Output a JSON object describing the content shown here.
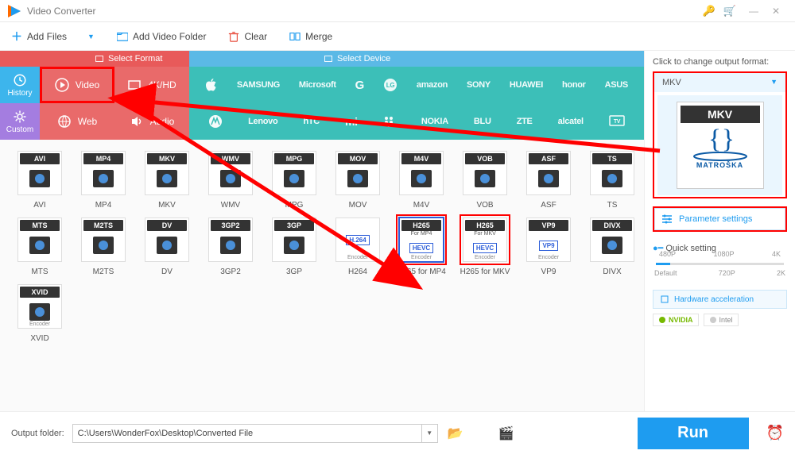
{
  "title": "Video Converter",
  "toolbar": {
    "add_files": "Add Files",
    "add_folder": "Add Video Folder",
    "clear": "Clear",
    "merge": "Merge"
  },
  "tabs": {
    "select_format": "Select Format",
    "select_device": "Select Device"
  },
  "side": {
    "history": "History",
    "custom": "Custom"
  },
  "cats": {
    "video": "Video",
    "fourk": "4K/HD",
    "web": "Web",
    "audio": "Audio"
  },
  "brands_row1": [
    "",
    "SAMSUNG",
    "Microsoft",
    "G",
    "LG",
    "amazon",
    "SONY",
    "HUAWEI",
    "honor",
    "ASUS"
  ],
  "brands_row2": [
    "",
    "Lenovo",
    "hTC",
    "mi",
    "",
    "NOKIA",
    "BLU",
    "ZTE",
    "alcatel",
    "TV"
  ],
  "formats": [
    {
      "badge": "AVI",
      "label": "AVI"
    },
    {
      "badge": "MP4",
      "label": "MP4"
    },
    {
      "badge": "MKV",
      "label": "MKV"
    },
    {
      "badge": "WMV",
      "label": "WMV"
    },
    {
      "badge": "MPG",
      "label": "MPG"
    },
    {
      "badge": "MOV",
      "label": "MOV"
    },
    {
      "badge": "M4V",
      "label": "M4V"
    },
    {
      "badge": "VOB",
      "label": "VOB"
    },
    {
      "badge": "ASF",
      "label": "ASF"
    },
    {
      "badge": "TS",
      "label": "TS"
    },
    {
      "badge": "MTS",
      "label": "MTS"
    },
    {
      "badge": "M2TS",
      "label": "M2TS"
    },
    {
      "badge": "DV",
      "label": "DV"
    },
    {
      "badge": "3GP2",
      "label": "3GP2"
    },
    {
      "badge": "3GP",
      "label": "3GP"
    },
    {
      "badge": "",
      "label": "H264",
      "art": "H.264",
      "enc": "Encoder"
    },
    {
      "badge": "H265",
      "label": "H265 for MP4",
      "art": "HEVC",
      "sub": "For MP4",
      "enc": "Encoder",
      "selected": true,
      "highlight": true
    },
    {
      "badge": "H265",
      "label": "H265 for MKV",
      "art": "HEVC",
      "sub": "For MKV",
      "enc": "Encoder",
      "highlight": true
    },
    {
      "badge": "VP9",
      "label": "VP9",
      "art": "VP9",
      "enc": "Encoder"
    },
    {
      "badge": "DIVX",
      "label": "DIVX"
    },
    {
      "badge": "XVID",
      "label": "XVID",
      "enc": "Encoder"
    }
  ],
  "right": {
    "click_label": "Click to change output format:",
    "current": "MKV",
    "brand": "MATROŠKA",
    "param": "Parameter settings",
    "quick": "Quick setting",
    "qs_top": [
      "480P",
      "1080P",
      "4K"
    ],
    "qs_bot": [
      "Default",
      "720P",
      "2K"
    ],
    "hw": "Hardware acceleration",
    "nvidia": "NVIDIA",
    "intel": "Intel"
  },
  "bottom": {
    "label": "Output folder:",
    "path": "C:\\Users\\WonderFox\\Desktop\\Converted File",
    "run": "Run"
  }
}
